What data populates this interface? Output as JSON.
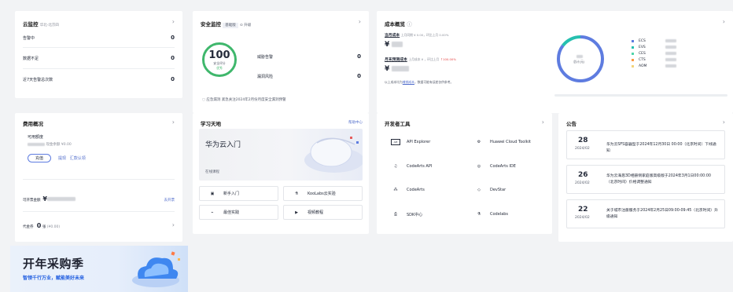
{
  "monitor": {
    "title": "云监控",
    "region": "华北-北京四",
    "rows": [
      {
        "label": "告警中",
        "value": "0"
      },
      {
        "label": "数据不足",
        "value": "0"
      },
      {
        "label": "近7天告警总次数",
        "value": "0"
      }
    ]
  },
  "security": {
    "title": "安全监控",
    "badge": "基础版",
    "upgrade": "升级",
    "score": "100",
    "score_label": "安全评分",
    "score_status": "优秀",
    "rows": [
      {
        "label": "威胁告警",
        "value": "0"
      },
      {
        "label": "漏洞风险",
        "value": "0"
      }
    ],
    "notice": "应急漏洞 紧急关注2024年2月份月度安全漏洞预警"
  },
  "cost": {
    "title": "成本概览",
    "section1": "当月成本",
    "s1_note": "上月同期 ¥ 0.00，环比上月 0.00%",
    "section2": "月末预测成本",
    "s2_note": "上月成本 ¥ ，环比上月",
    "s2_pct": "100.00%",
    "currency": "¥",
    "footer_text": "以上成本均为",
    "footer_link": "摊销成本",
    "footer_rest": "，数据可能有误差仅供参考。",
    "legend": [
      {
        "name": "ECS",
        "color": "#5e7ce0"
      },
      {
        "name": "EVS",
        "color": "#26c0b0"
      },
      {
        "name": "CES",
        "color": "#50d4ab"
      },
      {
        "name": "CTS",
        "color": "#fa9841"
      },
      {
        "name": "AOM",
        "color": "#f3d47b"
      }
    ],
    "donut_label": "总计(元)"
  },
  "fee": {
    "title": "费用概况",
    "available": "可用额度",
    "cash_label": "现金余额 ¥0.00",
    "btn_recharge": "充值",
    "btn_withdraw": "提现",
    "btn_remit": "汇款认领",
    "invoice_label": "可开票金额",
    "invoice_currency": "¥",
    "invoice_link": "去开票",
    "voucher_label": "代金券",
    "voucher_count": "0",
    "voucher_unit": "张",
    "voucher_amount": "(¥0.00)"
  },
  "learn": {
    "title": "学习天地",
    "help": "帮助中心",
    "banner_title": "华为云入门",
    "banner_sub": "在线课程",
    "tiles": [
      "新手入门",
      "KooLabs云实验",
      "最佳实践",
      "视频教程"
    ]
  },
  "dev": {
    "title": "开发者工具",
    "tiles": [
      "API Explorer",
      "Huawei Cloud Toolkit",
      "CodeArts API",
      "CodeArts IDE",
      "CodeArts",
      "DevStar",
      "SDK中心",
      "Codelabs"
    ]
  },
  "notice": {
    "title": "公告",
    "items": [
      {
        "day": "28",
        "ym": "2024/02",
        "text": "华为云SFS容器型于2024年12月30日 00:00（北京时间）下线通知"
      },
      {
        "day": "26",
        "ym": "2024/02",
        "text": "华为云海思3D相册侧家庭版高级版于2024年3月1日00:00:00（北京时间）价格调整通知"
      },
      {
        "day": "22",
        "ym": "2024/02",
        "text": "关于城市注册服务于2024年2月25日09:00-09:45（北京时间）升级通知"
      }
    ]
  },
  "promo": {
    "title": "开年采购季",
    "subtitle": "智领千行万业，赋能美好未来"
  }
}
